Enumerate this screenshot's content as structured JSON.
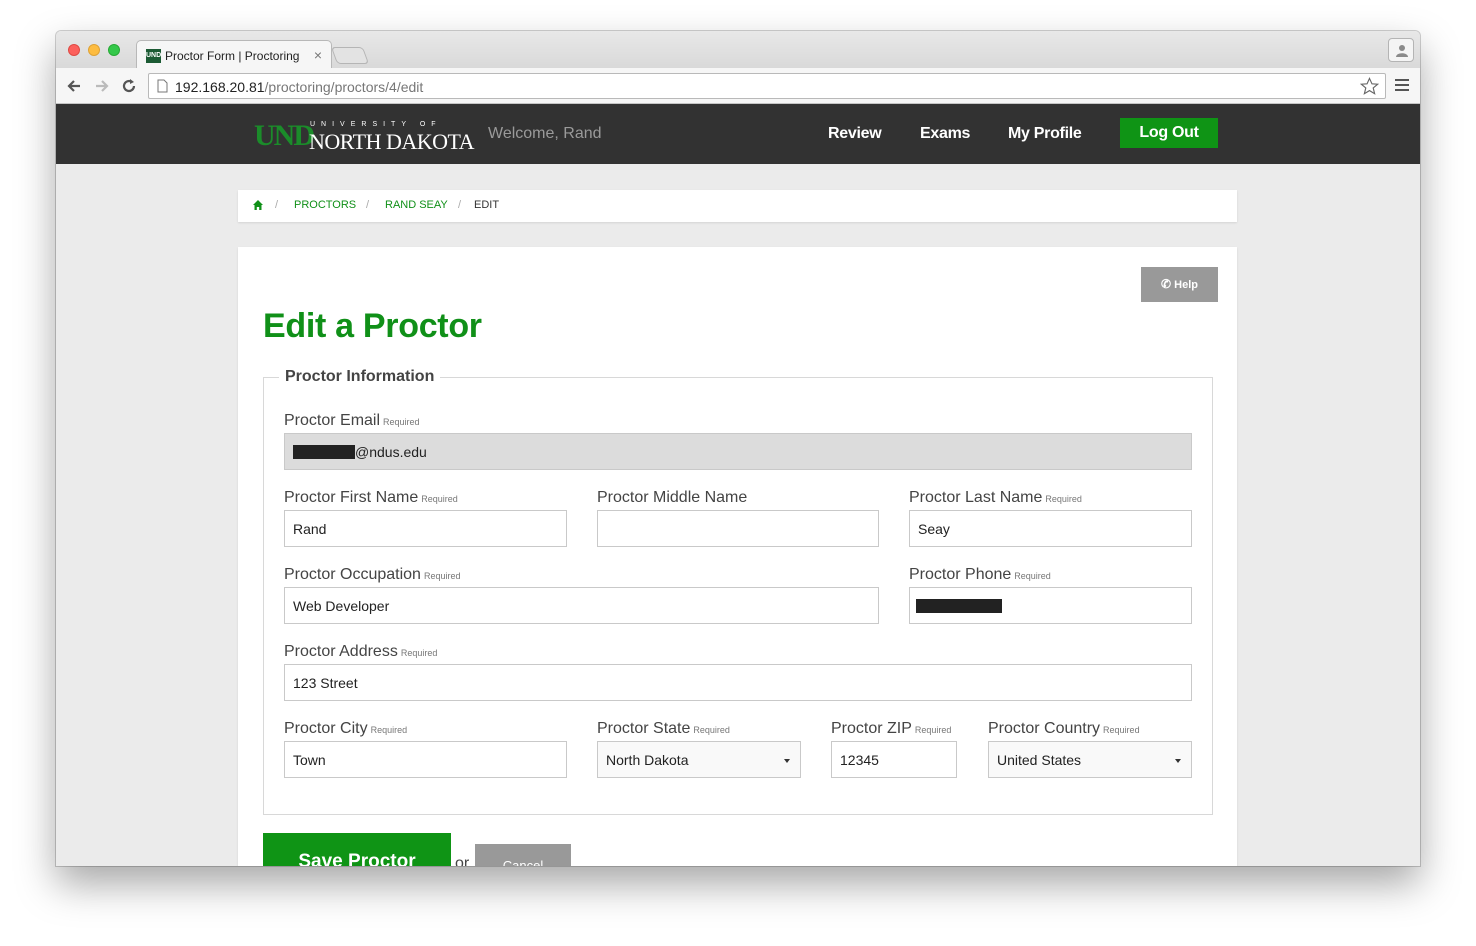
{
  "browser": {
    "tab_title": "Proctor Form | Proctoring",
    "tab_favicon": "UND",
    "url_host": "192.168.20.81",
    "url_path": "/proctoring/proctors/4/edit"
  },
  "nav": {
    "logo_und": "UND",
    "logo_university": "UNIVERSITY OF",
    "logo_nd": "NORTH DAKOTA",
    "welcome": "Welcome, Rand",
    "links": [
      "Review",
      "Exams",
      "My Profile"
    ],
    "logout": "Log Out"
  },
  "breadcrumb": {
    "items": [
      "PROCTORS",
      "RAND SEAY"
    ],
    "current": "EDIT",
    "separator": "/"
  },
  "page": {
    "help_label": "Help",
    "title": "Edit a Proctor",
    "legend": "Proctor Information",
    "required": "Required"
  },
  "fields": {
    "email": {
      "label": "Proctor Email",
      "value_suffix": "@ndus.edu"
    },
    "first_name": {
      "label": "Proctor First Name",
      "value": "Rand"
    },
    "middle_name": {
      "label": "Proctor Middle Name",
      "value": ""
    },
    "last_name": {
      "label": "Proctor Last Name",
      "value": "Seay"
    },
    "occupation": {
      "label": "Proctor Occupation",
      "value": "Web Developer"
    },
    "phone": {
      "label": "Proctor Phone"
    },
    "address": {
      "label": "Proctor Address",
      "value": "123 Street"
    },
    "city": {
      "label": "Proctor City",
      "value": "Town"
    },
    "state": {
      "label": "Proctor State",
      "value": "North Dakota"
    },
    "zip": {
      "label": "Proctor ZIP",
      "value": "12345"
    },
    "country": {
      "label": "Proctor Country",
      "value": "United States"
    }
  },
  "actions": {
    "save": "Save Proctor",
    "or": "or",
    "cancel": "Cancel"
  },
  "colors": {
    "brand_green": "#0f9415",
    "nav_bg": "#323232",
    "page_bg": "#ebebeb"
  }
}
